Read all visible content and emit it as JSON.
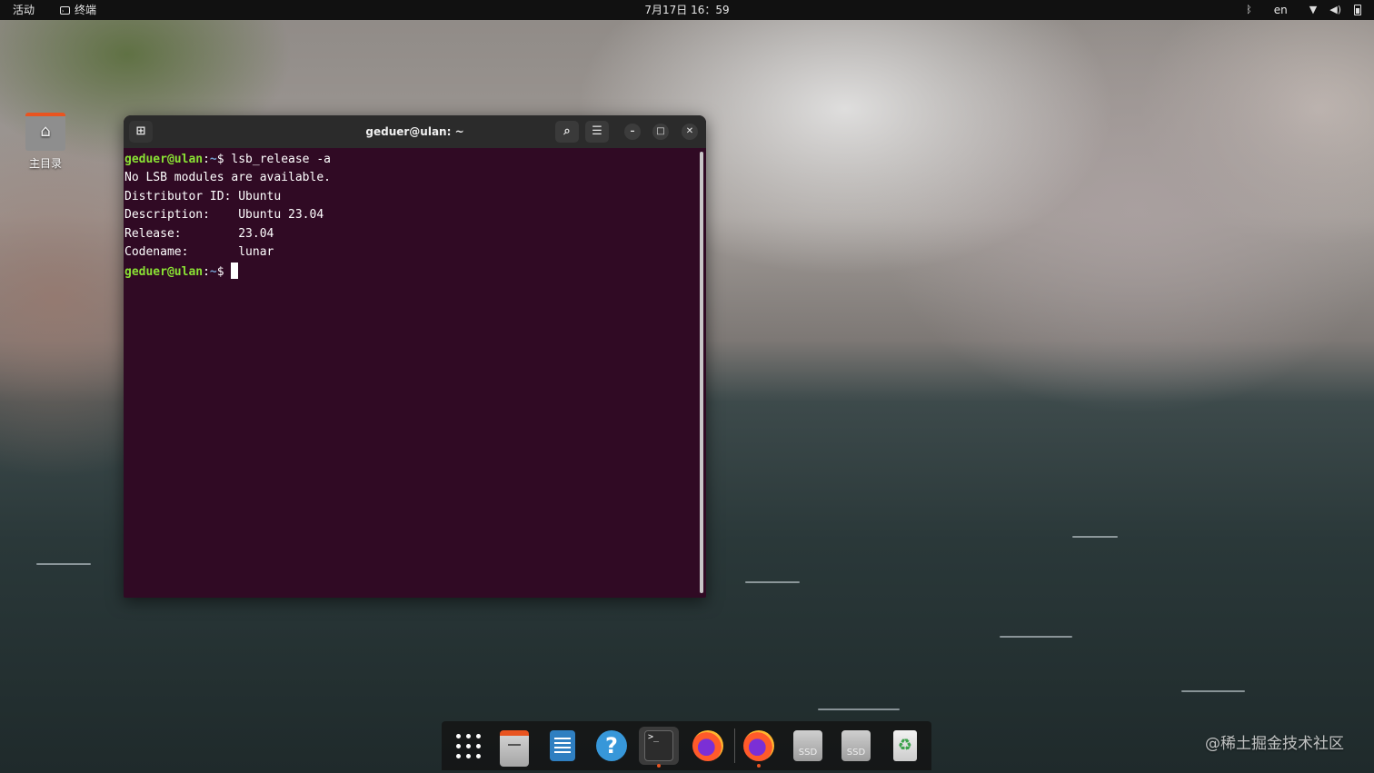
{
  "topbar": {
    "activities": "活动",
    "app_name": "终端",
    "clock": "7月17日 16：59",
    "input_source": "en",
    "icons": [
      "bluetooth-icon",
      "wifi-icon",
      "volume-icon",
      "battery-icon"
    ]
  },
  "desktop": {
    "home_label": "主目录"
  },
  "terminal": {
    "title": "geduer@ulan: ~",
    "prompt_user": "geduer@ulan",
    "prompt_sep": ":",
    "prompt_path": "~",
    "prompt_sign": "$ ",
    "command": "lsb_release -a",
    "output": [
      "No LSB modules are available.",
      "Distributor ID:\tUbuntu",
      "Description:\tUbuntu 23.04",
      "Release:\t23.04",
      "Codename:\tlunar"
    ]
  },
  "dock": {
    "items": [
      "show-apps",
      "files",
      "libreoffice-writer",
      "help",
      "terminal",
      "firefox",
      "firefox",
      "ssd-drive",
      "ssd-drive",
      "trash"
    ],
    "ssd_label": "SSD",
    "terminal_glyph": ">_"
  },
  "watermark": "@稀土掘金技术社区",
  "colors": {
    "terminal_bg": "#300a24",
    "prompt_user": "#8ae234",
    "prompt_path": "#729fcf",
    "ubuntu_orange": "#e95420"
  }
}
